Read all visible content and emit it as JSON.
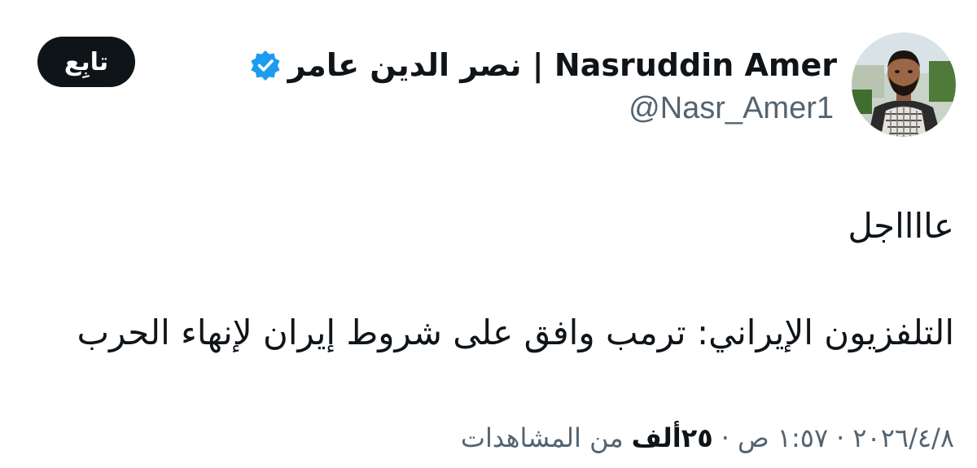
{
  "author": {
    "display_name": "نصر الدين عامر | Nasruddin Amer",
    "handle": "@Nasr_Amer1",
    "avatar_icon": "profile-photo",
    "verified_icon": "verified-badge-icon"
  },
  "follow_button": {
    "label": "تابِع"
  },
  "tweet": {
    "line1": "عااااجل",
    "line2": "التلفزيون الإيراني: ترمب وافق على شروط إيران لإنهاء الحرب"
  },
  "meta": {
    "date": "٢٠٢٦/٤/٨",
    "separator": "·",
    "time": "١:٥٧ ص",
    "views_count": "٢٥ألف",
    "views_label": "من المشاهدات"
  },
  "colors": {
    "text_primary": "#0f1419",
    "text_secondary": "#536471",
    "verified_blue": "#1d9bf0",
    "button_bg": "#0f1419"
  }
}
